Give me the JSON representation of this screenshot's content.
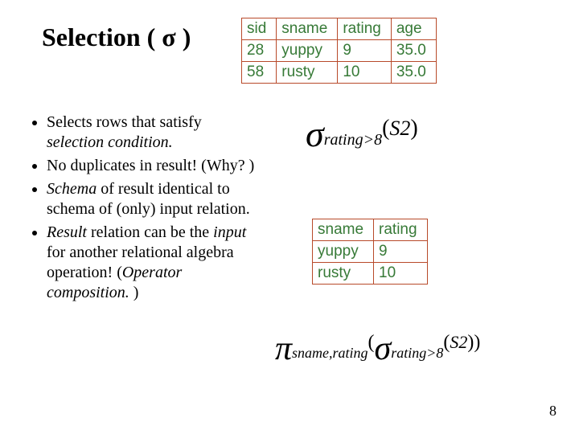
{
  "title_prefix": "Selection ( ",
  "title_sigma": "σ",
  "title_suffix": " )",
  "bullets": {
    "b1a": "Selects rows that satisfy ",
    "b1b": "selection condition.",
    "b2": "No duplicates in result! (Why? )",
    "b3a": "Schema",
    "b3b": " of result identical to schema of (only) input relation.",
    "b4a": "Result",
    "b4b": " relation can be the ",
    "b4c": "input",
    "b4d": " for another relational algebra operation! (",
    "b4e": "Operator composition.",
    "b4f": " )"
  },
  "table1": {
    "headers": {
      "c1": "sid",
      "c2": "sname",
      "c3": "rating",
      "c4": "age"
    },
    "rows": [
      {
        "c1": "28",
        "c2": "yuppy",
        "c3": "9",
        "c4": "35.0"
      },
      {
        "c1": "58",
        "c2": "rusty",
        "c3": "10",
        "c4": "35.0"
      }
    ]
  },
  "table2": {
    "headers": {
      "c1": "sname",
      "c2": "rating"
    },
    "rows": [
      {
        "c1": "yuppy",
        "c2": "9"
      },
      {
        "c1": "rusty",
        "c2": "10"
      }
    ]
  },
  "formula1": {
    "op": "σ",
    "sub": "rating>8",
    "lp": "(",
    "arg": "S2",
    "rp": ")"
  },
  "formula2": {
    "op1": "π",
    "sub1": "sname,rating",
    "lp1": "(",
    "op2": "σ",
    "sub2": "rating>8",
    "lp2": "(",
    "arg": "S2",
    "rp2": ")",
    "rp1": ")"
  },
  "pagenum": "8",
  "chart_data": {
    "type": "table",
    "tables": [
      {
        "columns": [
          "sid",
          "sname",
          "rating",
          "age"
        ],
        "rows": [
          [
            28,
            "yuppy",
            9,
            35.0
          ],
          [
            58,
            "rusty",
            10,
            35.0
          ]
        ]
      },
      {
        "columns": [
          "sname",
          "rating"
        ],
        "rows": [
          [
            "yuppy",
            9
          ],
          [
            "rusty",
            10
          ]
        ]
      }
    ]
  }
}
